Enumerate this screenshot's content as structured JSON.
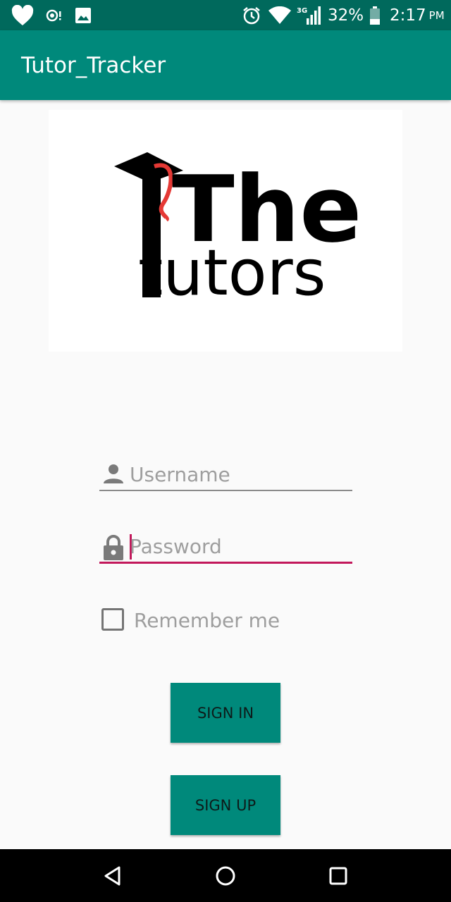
{
  "status_bar": {
    "icons": [
      "heart-icon",
      "hotspot-icon",
      "image-icon",
      "alarm-icon",
      "wifi-icon",
      "signal-3g-icon",
      "battery-icon"
    ],
    "network": "3G",
    "battery": "32%",
    "time": "2:17",
    "ampm": "PM"
  },
  "app_bar": {
    "title": "Tutor_Tracker"
  },
  "logo": {
    "line1": "The",
    "line2": "tutors",
    "accent_color": "#e53935"
  },
  "form": {
    "username_placeholder": "Username",
    "password_placeholder": "Password",
    "remember_label": "Remember me",
    "remember_checked": false
  },
  "buttons": {
    "sign_in": "SIGN IN",
    "sign_up": "SIGN UP"
  },
  "colors": {
    "primary": "#00897b",
    "primary_dark": "#00695c",
    "accent": "#c2185b"
  }
}
